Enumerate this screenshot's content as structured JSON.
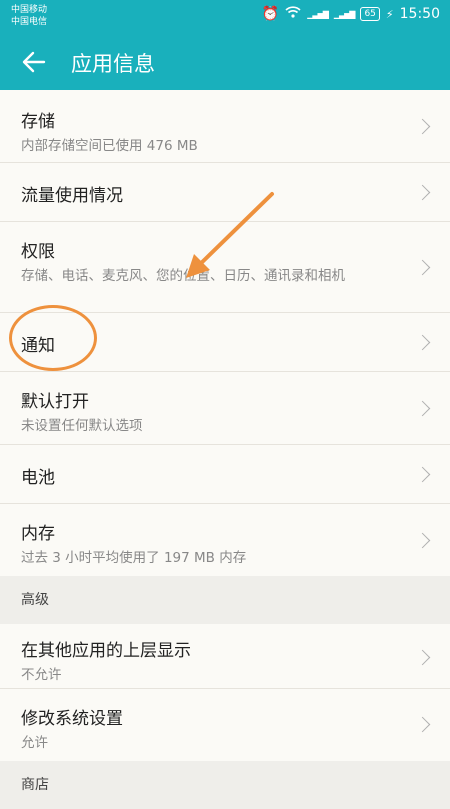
{
  "status": {
    "carrier1": "中国移动",
    "carrier2": "中国电信",
    "battery": "65",
    "time": "15:50"
  },
  "header": {
    "title": "应用信息"
  },
  "items": [
    {
      "title": "存储",
      "subtitle": "内部存储空间已使用 476 MB"
    },
    {
      "title": "流量使用情况",
      "subtitle": ""
    },
    {
      "title": "权限",
      "subtitle": "存储、电话、麦克风、您的位置、日历、通讯录和相机"
    },
    {
      "title": "通知",
      "subtitle": ""
    },
    {
      "title": "默认打开",
      "subtitle": "未设置任何默认选项"
    },
    {
      "title": "电池",
      "subtitle": ""
    },
    {
      "title": "内存",
      "subtitle": "过去 3 小时平均使用了 197 MB 内存"
    }
  ],
  "sections": {
    "advanced": "高级",
    "store": "商店"
  },
  "advanced_items": [
    {
      "title": "在其他应用的上层显示",
      "subtitle": "不允许"
    },
    {
      "title": "修改系统设置",
      "subtitle": "允许"
    }
  ],
  "colors": {
    "accent": "#19b0bc",
    "annotation": "#ee913d"
  }
}
